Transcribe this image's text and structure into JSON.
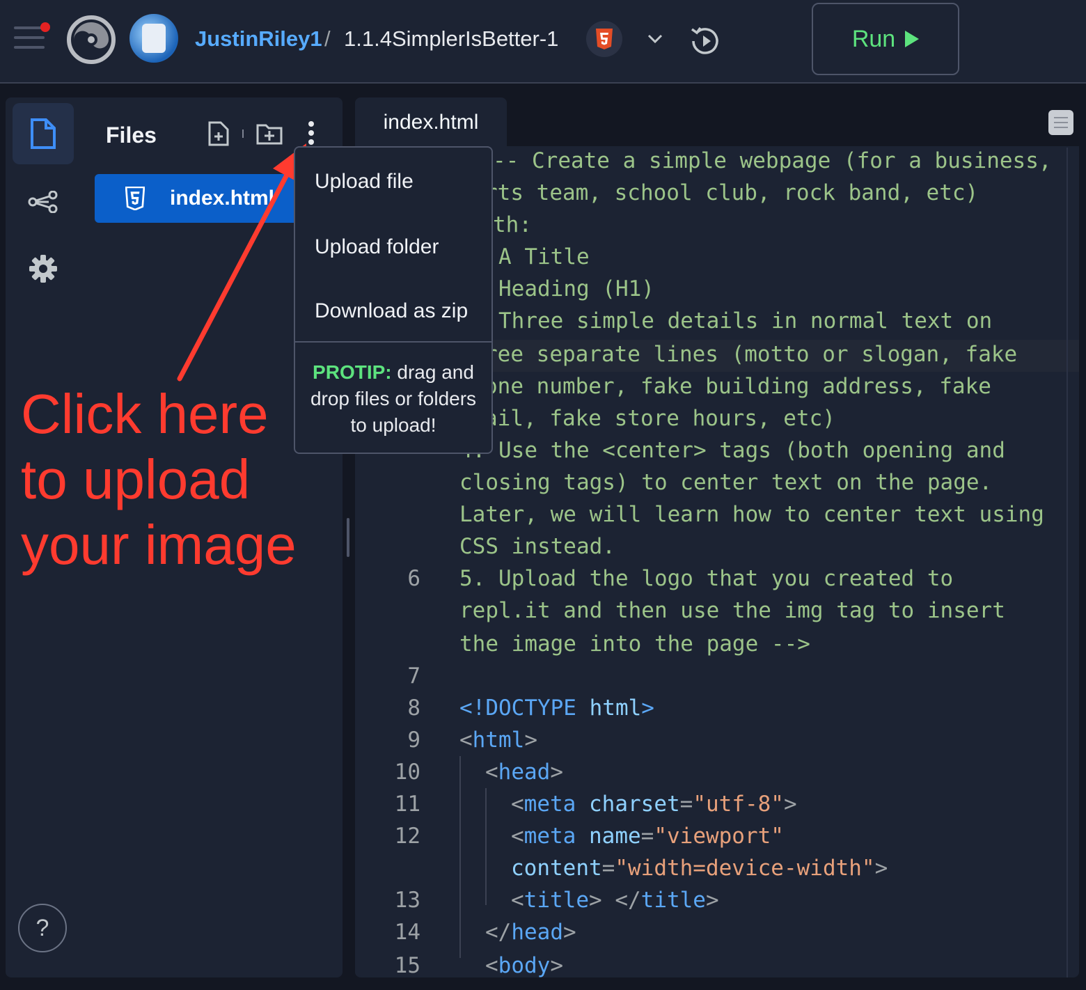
{
  "header": {
    "username": "JustinRiley1",
    "separator": "/",
    "repl_name": "1.1.4SimplerIsBetter-1",
    "run_label": "Run",
    "accent_color": "#5de37e",
    "username_color": "#57abff"
  },
  "sidebar": {
    "files_title": "Files",
    "active_file": "index.html",
    "help_label": "?"
  },
  "dropdown": {
    "items": [
      "Upload file",
      "Upload folder",
      "Download as zip"
    ],
    "protip_label": "PROTIP:",
    "protip_text_1": " drag and",
    "protip_text_2": "drop files or folders",
    "protip_text_3": "to upload!"
  },
  "annotation": {
    "line1": "Click here",
    "line2": "to upload",
    "line3": "your image",
    "color": "#ff3b2f"
  },
  "editor": {
    "tab_label": "index.html",
    "line_numbers": {
      "n6": "6",
      "n7": "7",
      "n8": "8",
      "n9": "9",
      "n10": "10",
      "n11": "11",
      "n12": "12",
      "n13": "13",
      "n14": "14",
      "n15": "15"
    },
    "lines": {
      "l1": "-- Create a simple webpage (for a business,",
      "l2": "rts team, school club, rock band, etc)",
      "l3": "th:",
      "l4": "A Title",
      "l5": "Heading (H1)",
      "l6": "Three simple details in normal text on",
      "l7": "ree separate lines (motto or slogan, fake",
      "l8": "one number, fake building address, fake",
      "l9": "ail, fake store hours, etc)",
      "l10": "4. Use the <center> tags (both opening and",
      "l11": "closing tags) to center text on the page.",
      "l12": "Later, we will learn how to center text using",
      "l13": "CSS instead.",
      "l14": "5. Upload the logo that you created to",
      "l15": "repl.it and then use the img tag to insert",
      "l16": "the image into the page -->",
      "doctype_open": "<!DOCTYPE ",
      "doctype_html": "html",
      "doctype_close": ">",
      "html_lt": "<",
      "html_tag": "html",
      "html_gt": ">",
      "head_lt": "<",
      "head_tag": "head",
      "head_gt": ">",
      "meta1_lt": "<",
      "meta1_tag": "meta",
      "meta1_attr": "charset",
      "meta1_eq": "=",
      "meta1_val": "\"utf-8\"",
      "meta1_gt": ">",
      "meta2_lt": "<",
      "meta2_tag": "meta",
      "meta2_attr": "name",
      "meta2_eq": "=",
      "meta2_val": "\"viewport\"",
      "content_attr": "content",
      "content_eq": "=",
      "content_val": "\"width=device-width\"",
      "content_gt": ">",
      "title_lt": "<",
      "title_tag": "title",
      "title_mid": "> </",
      "title_tag2": "title",
      "title_gt": ">",
      "chead_lt": "</",
      "chead_tag": "head",
      "chead_gt": ">",
      "body_lt": "<",
      "body_tag": "body",
      "body_gt": ">"
    }
  }
}
